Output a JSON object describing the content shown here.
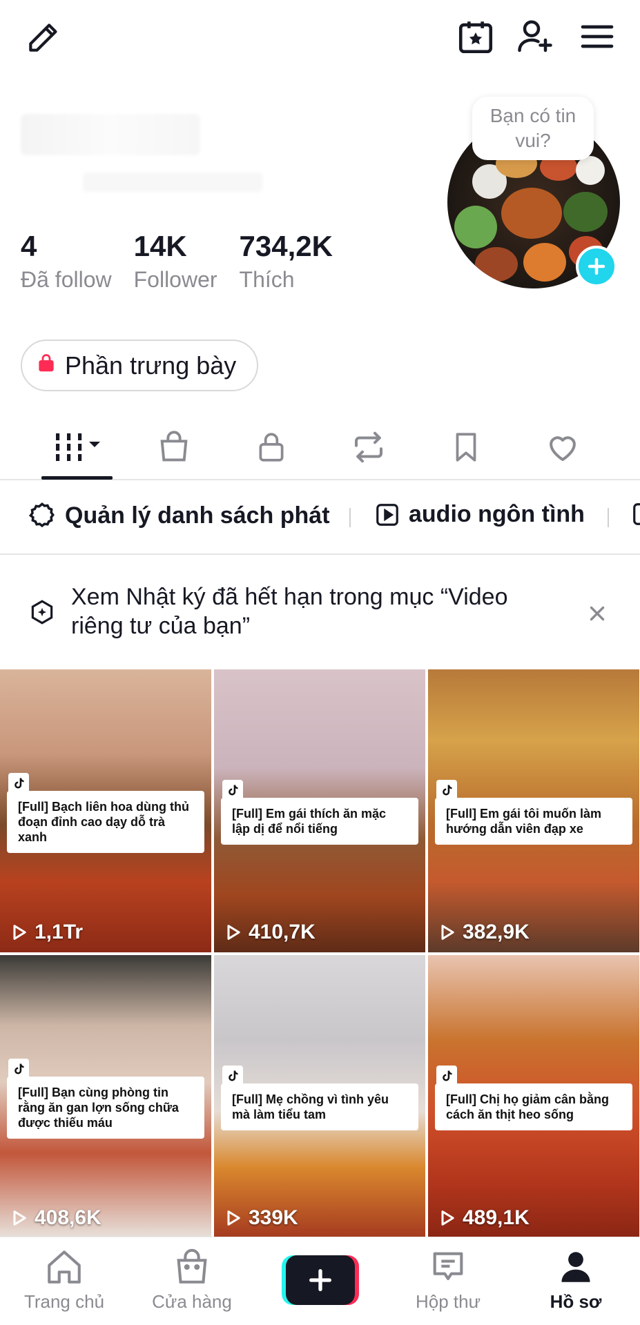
{
  "header": {
    "edit_icon": "pencil-icon",
    "calendar_icon": "calendar-star-icon",
    "add_friend_icon": "add-user-icon",
    "menu_icon": "hamburger-icon"
  },
  "profile": {
    "avatar_bubble": "Bạn có tin vui?",
    "stats": [
      {
        "value": "4",
        "label": "Đã follow"
      },
      {
        "value": "14K",
        "label": "Follower"
      },
      {
        "value": "734,2K",
        "label": "Thích"
      }
    ],
    "showcase_label": "Phần trưng bày"
  },
  "tabs": [
    "videos",
    "shop",
    "private",
    "reposts",
    "favorites",
    "liked"
  ],
  "playlists": [
    {
      "label": "Quản lý danh sách phát",
      "icon": "gear-icon"
    },
    {
      "label": "audio ngôn tình",
      "icon": "play-box-icon"
    }
  ],
  "notice": {
    "text": "Xem Nhật ký đã hết hạn trong mục “Video riêng tư của bạn”"
  },
  "videos": [
    {
      "caption": "[Full] Bạch liên hoa dùng thủ đoạn đỉnh cao dạy dỗ trà xanh",
      "views": "1,1Tr"
    },
    {
      "caption": "[Full] Em gái thích ăn mặc lập dị để nổi tiếng",
      "views": "410,7K"
    },
    {
      "caption": "[Full] Em gái tôi muốn làm hướng dẫn viên đạp xe",
      "views": "382,9K"
    },
    {
      "caption": "[Full] Bạn cùng phòng tin rằng ăn gan lợn sống chữa được thiếu máu",
      "views": "408,6K"
    },
    {
      "caption": "[Full] Mẹ chồng vì tình yêu mà làm tiểu tam",
      "views": "339K"
    },
    {
      "caption": "[Full] Chị họ giảm cân bằng cách ăn thịt heo sống",
      "views": "489,1K"
    }
  ],
  "bottom_nav": [
    {
      "label": "Trang chủ",
      "icon": "home-icon"
    },
    {
      "label": "Cửa hàng",
      "icon": "shopping-bag-icon"
    },
    {
      "label": "",
      "icon": "plus-icon"
    },
    {
      "label": "Hộp thư",
      "icon": "inbox-icon"
    },
    {
      "label": "Hồ sơ",
      "icon": "profile-icon"
    }
  ]
}
